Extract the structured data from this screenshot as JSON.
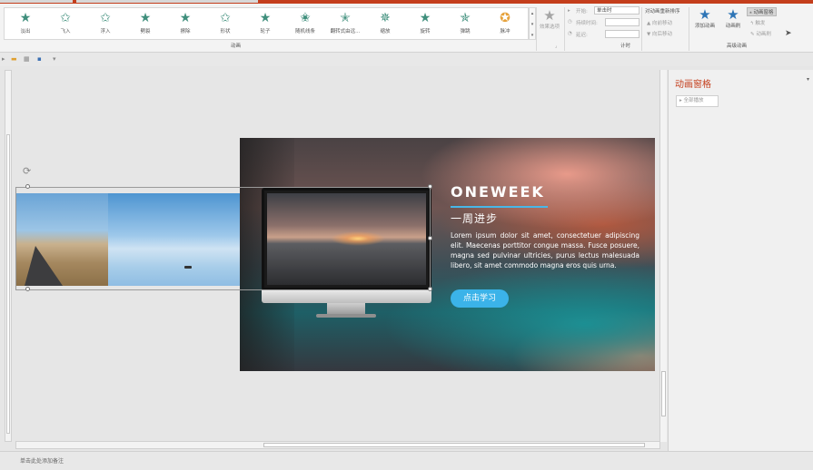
{
  "ribbon": {
    "effects": [
      {
        "name": "fade",
        "label": "淡出",
        "icon": "star-fade-icon"
      },
      {
        "name": "fly-in",
        "label": "飞入",
        "icon": "star-fly-in-icon"
      },
      {
        "name": "float-in",
        "label": "浮入",
        "icon": "star-float-in-icon"
      },
      {
        "name": "split",
        "label": "劈裂",
        "icon": "star-split-icon"
      },
      {
        "name": "wipe",
        "label": "擦除",
        "icon": "star-wipe-icon"
      },
      {
        "name": "shape",
        "label": "形状",
        "icon": "star-shape-icon"
      },
      {
        "name": "wheel",
        "label": "轮子",
        "icon": "star-wheel-icon"
      },
      {
        "name": "random-bars",
        "label": "随机线条",
        "icon": "star-random-bars-icon"
      },
      {
        "name": "grow-turn",
        "label": "翻转式由远...",
        "icon": "star-grow-turn-icon"
      },
      {
        "name": "zoom",
        "label": "缩放",
        "icon": "star-zoom-icon"
      },
      {
        "name": "swivel",
        "label": "旋转",
        "icon": "star-swivel-icon"
      },
      {
        "name": "bounce",
        "label": "弹跳",
        "icon": "star-bounce-icon"
      },
      {
        "name": "pulse",
        "label": "脉冲",
        "icon": "star-pulse-icon"
      }
    ],
    "effect_options_label": "效果选项",
    "animation_group_label": "动画",
    "timing": {
      "start_label": "开始:",
      "start_value": "单击时",
      "duration_label": "持续时间:",
      "delay_label": "延迟:",
      "group_label": "计时"
    },
    "reorder": {
      "title": "对动画重新排序",
      "move_earlier": "向前移动",
      "move_later": "向后移动"
    },
    "advanced": {
      "add_animation": "添加动画",
      "animation_painter": "动画刷",
      "animation_pane": "动画窗格",
      "trigger": "触发",
      "group_label": "高级动画"
    }
  },
  "slide": {
    "headline": "ONEWEEK",
    "subhead": "一周进步",
    "body": "Lorem ipsum dolor sit amet, consectetuer adipiscing elit. Maecenas porttitor congue massa. Fusce posuere, magna sed pulvinar ultricies, purus lectus malesuada libero, sit amet commodo magna eros quis urna.",
    "cta": "点击学习"
  },
  "notes": {
    "placeholder": "单击此处添加备注"
  },
  "pane": {
    "title": "动画窗格",
    "play_all": "全部播放"
  },
  "colors": {
    "accent": "#c43e1c",
    "cta": "#3bb3e9",
    "star": "#3f8f7c"
  }
}
